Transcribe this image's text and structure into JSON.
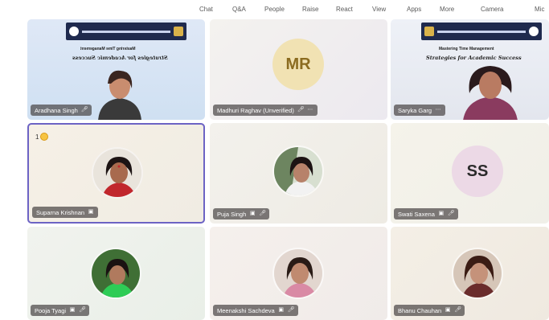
{
  "toolbar": {
    "items": [
      "Chat",
      "Q&A",
      "People",
      "Raise",
      "React",
      "View",
      "Apps",
      "More",
      "Camera",
      "Mic"
    ]
  },
  "participants": [
    {
      "name": "Aradhana Singh",
      "type": "slide",
      "slide_title": "Mastering Time Management",
      "slide_subtitle": "Strategies for Academic Success"
    },
    {
      "name": "Madhuri Raghav (Unverified)",
      "type": "initials",
      "initials": "MR"
    },
    {
      "name": "Saryka Garg",
      "type": "slide",
      "slide_title": "Mastering Time Management",
      "slide_subtitle": "Strategies for Academic Success"
    },
    {
      "name": "Suparna Krishnan",
      "type": "photo",
      "reaction_count": "1"
    },
    {
      "name": "Puja Singh",
      "type": "photo"
    },
    {
      "name": "Swati Saxena",
      "type": "initials",
      "initials": "SS"
    },
    {
      "name": "Pooja Tyagi",
      "type": "photo"
    },
    {
      "name": "Meenakshi Sachdeva",
      "type": "photo"
    },
    {
      "name": "Bhanu Chauhan",
      "type": "photo"
    }
  ],
  "colors": {
    "selected_border": "#6c63c4",
    "nametag_bg": "#4b4646",
    "mr_avatar_bg": "#f1e2b3",
    "mr_text": "#8b6b1f",
    "ss_avatar_bg": "#ecd9e6",
    "ss_text": "#2b2b2b"
  }
}
